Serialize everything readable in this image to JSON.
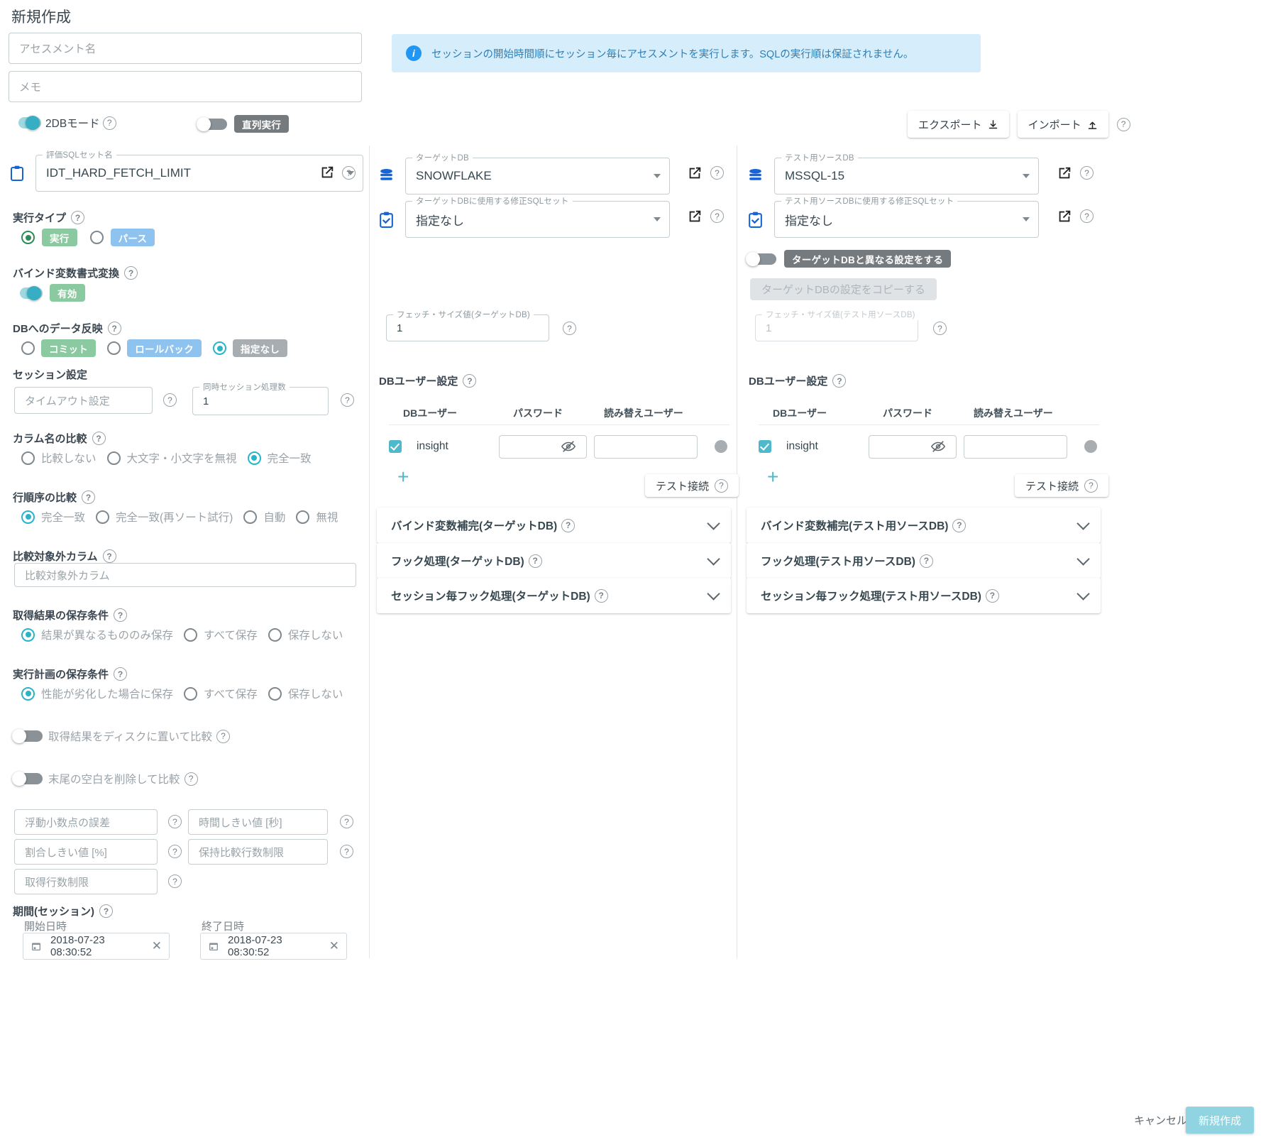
{
  "page": {
    "title": "新規作成"
  },
  "top": {
    "assessment_name_placeholder": "アセスメント名",
    "memo_placeholder": "メモ",
    "two_db_mode_label": "2DBモード",
    "serial_exec_chip": "直列実行",
    "export_label": "エクスポート",
    "import_label": "インポート",
    "info_message": "セッションの開始時間順にセッション毎にアセスメントを実行します。SQLの実行順は保証されません。"
  },
  "left": {
    "sqlset": {
      "label": "評価SQLセット名",
      "value": "IDT_HARD_FETCH_LIMIT"
    },
    "exec_type": {
      "label": "実行タイプ",
      "options": [
        {
          "label": "実行",
          "selected": true,
          "color": "green"
        },
        {
          "label": "パース",
          "selected": false,
          "color": "blue"
        }
      ]
    },
    "bind_convert": {
      "label": "バインド変数書式変換",
      "chip": "有効",
      "on": true
    },
    "db_reflect": {
      "label": "DBへのデータ反映",
      "options": [
        {
          "label": "コミット",
          "selected": false,
          "color": "green"
        },
        {
          "label": "ロールバック",
          "selected": false,
          "color": "blue"
        },
        {
          "label": "指定なし",
          "selected": true,
          "color": "grey2"
        }
      ]
    },
    "session": {
      "label": "セッション設定",
      "timeout_placeholder": "タイムアウト設定",
      "concurrent_label": "同時セッション処理数",
      "concurrent_value": "1"
    },
    "column_name_compare": {
      "label": "カラム名の比較",
      "options": [
        {
          "label": "比較しない",
          "selected": false
        },
        {
          "label": "大文字・小文字を無視",
          "selected": false
        },
        {
          "label": "完全一致",
          "selected": true
        }
      ]
    },
    "row_order_compare": {
      "label": "行順序の比較",
      "options": [
        {
          "label": "完全一致",
          "selected": true
        },
        {
          "label": "完全一致(再ソート試行)",
          "selected": false
        },
        {
          "label": "自動",
          "selected": false
        },
        {
          "label": "無視",
          "selected": false
        }
      ]
    },
    "excluded_columns": {
      "label": "比較対象外カラム",
      "placeholder": "比較対象外カラム"
    },
    "result_save": {
      "label": "取得結果の保存条件",
      "options": [
        {
          "label": "結果が異なるもののみ保存",
          "selected": true
        },
        {
          "label": "すべて保存",
          "selected": false
        },
        {
          "label": "保存しない",
          "selected": false
        }
      ]
    },
    "plan_save": {
      "label": "実行計画の保存条件",
      "options": [
        {
          "label": "性能が劣化した場合に保存",
          "selected": true
        },
        {
          "label": "すべて保存",
          "selected": false
        },
        {
          "label": "保存しない",
          "selected": false
        }
      ]
    },
    "disk_compare": {
      "label": "取得結果をディスクに置いて比較",
      "on": false
    },
    "trim_compare": {
      "label": "末尾の空白を削除して比較",
      "on": false
    },
    "thresholds": [
      {
        "placeholder": "浮動小数点の誤差"
      },
      {
        "placeholder": "時間しきい値 [秒]"
      },
      {
        "placeholder": "割合しきい値 [%]"
      },
      {
        "placeholder": "保持比較行数制限"
      },
      {
        "placeholder": "取得行数制限"
      }
    ],
    "period": {
      "label": "期間(セッション)",
      "start_label": "開始日時",
      "start_value": "2018-07-23 08:30:52",
      "end_label": "終了日時",
      "end_value": "2018-07-23 08:30:52"
    }
  },
  "target": {
    "db": {
      "label": "ターゲットDB",
      "value": "SNOWFLAKE"
    },
    "fix_sqlset": {
      "label": "ターゲットDBに使用する修正SQLセット",
      "value": "指定なし"
    },
    "fetch_size": {
      "label": "フェッチ・サイズ値(ターゲットDB)",
      "value": "1"
    },
    "db_user_settings": {
      "label": "DBユーザー設定",
      "columns": [
        "DBユーザー",
        "パスワード",
        "読み替えユーザー"
      ],
      "rows": [
        {
          "user": "insight",
          "checked": true,
          "password": "",
          "alias": ""
        }
      ],
      "add_label": "+",
      "test_connection_label": "テスト接続"
    },
    "accordions": [
      "バインド変数補完(ターゲットDB)",
      "フック処理(ターゲットDB)",
      "セッション毎フック処理(ターゲットDB)"
    ]
  },
  "source": {
    "db": {
      "label": "テスト用ソースDB",
      "value": "MSSQL-15"
    },
    "fix_sqlset": {
      "label": "テスト用ソースDBに使用する修正SQLセット",
      "value": "指定なし"
    },
    "diff_settings_chip": "ターゲットDBと異なる設定をする",
    "diff_settings_on": false,
    "copy_button": "ターゲットDBの設定をコピーする",
    "fetch_size": {
      "label": "フェッチ・サイズ値(テスト用ソースDB)",
      "value": "1"
    },
    "db_user_settings": {
      "label": "DBユーザー設定",
      "columns": [
        "DBユーザー",
        "パスワード",
        "読み替えユーザー"
      ],
      "rows": [
        {
          "user": "insight",
          "checked": true,
          "password": "",
          "alias": ""
        }
      ],
      "add_label": "+",
      "test_connection_label": "テスト接続"
    },
    "accordions": [
      "バインド変数補完(テスト用ソースDB)",
      "フック処理(テスト用ソースDB)",
      "セッション毎フック処理(テスト用ソースDB)"
    ]
  },
  "footer": {
    "cancel_label": "キャンセル",
    "create_label": "新規作成"
  },
  "colors": {
    "accent": "#4fb8ca",
    "info_bg": "#d6eefc",
    "info_fg": "#2f7fb5",
    "green": "#8bc9a0",
    "blue": "#8fc3ef"
  }
}
